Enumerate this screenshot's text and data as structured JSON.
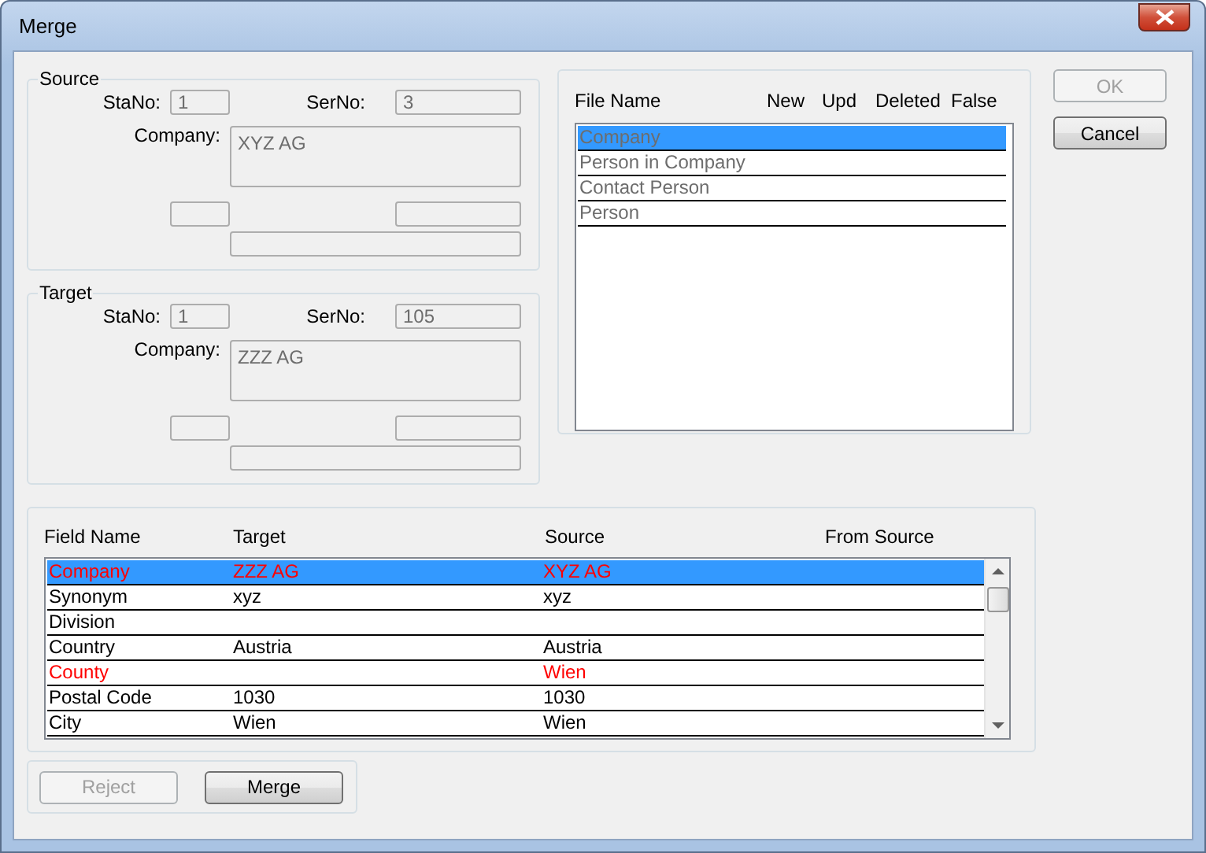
{
  "window": {
    "title": "Merge"
  },
  "groups": [
    {
      "label": "Source",
      "stano_label": "StaNo:",
      "stano": "1",
      "serno_label": "SerNo:",
      "serno": "3",
      "company_label": "Company:",
      "company": "XYZ AG"
    },
    {
      "label": "Target",
      "stano_label": "StaNo:",
      "stano": "1",
      "serno_label": "SerNo:",
      "serno": "105",
      "company_label": "Company:",
      "company": "ZZZ AG"
    }
  ],
  "files": {
    "columns": [
      "File Name",
      "New",
      "Upd",
      "Deleted",
      "False"
    ],
    "rows": [
      {
        "name": "Company",
        "selected": true
      },
      {
        "name": "Person in Company",
        "selected": false
      },
      {
        "name": "Contact Person",
        "selected": false
      },
      {
        "name": "Person",
        "selected": false
      }
    ]
  },
  "side_buttons": [
    {
      "label": "OK",
      "disabled": true
    },
    {
      "label": "Cancel",
      "disabled": false
    }
  ],
  "fields": {
    "columns": [
      "Field Name",
      "Target",
      "Source",
      "From Source"
    ],
    "rows": [
      {
        "field": "Company",
        "target": "ZZZ AG",
        "source": "XYZ AG",
        "differs": true,
        "selected": true
      },
      {
        "field": "Synonym",
        "target": "xyz",
        "source": "xyz",
        "differs": false,
        "selected": false
      },
      {
        "field": "Division",
        "differs": false,
        "selected": false
      },
      {
        "field": "Country",
        "target": "Austria",
        "source": "Austria",
        "differs": false,
        "selected": false
      },
      {
        "field": "County",
        "source": "Wien",
        "differs": true,
        "selected": false
      },
      {
        "field": "Postal Code",
        "target": "1030",
        "source": "1030",
        "differs": false,
        "selected": false
      },
      {
        "field": "City",
        "target": "Wien",
        "source": "Wien",
        "differs": false,
        "selected": false
      }
    ]
  },
  "bottom_buttons": [
    {
      "label": "Reject",
      "disabled": true
    },
    {
      "label": "Merge",
      "disabled": false
    }
  ]
}
